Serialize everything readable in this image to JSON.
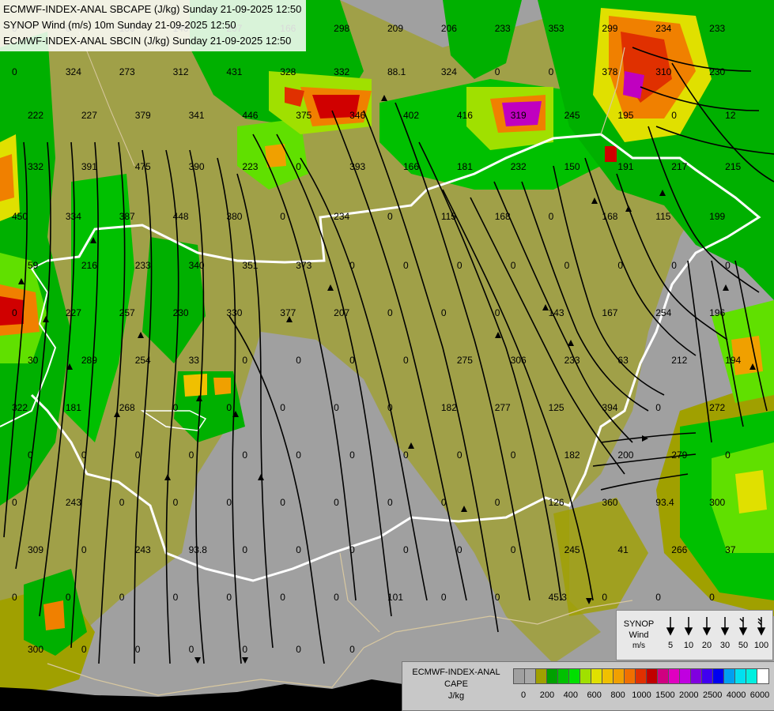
{
  "titles": {
    "line1": "ECMWF-INDEX-ANAL SBCAPE (J/kg) Sunday 21-09-2025 12:50",
    "line2": "SYNOP Wind (m/s) 10m Sunday 21-09-2025 12:50",
    "line3": "ECMWF-INDEX-ANAL SBCIN (J/kg) Sunday 21-09-2025 12:50"
  },
  "wind_legend": {
    "title": "SYNOP",
    "subtitle": "Wind",
    "unit": "m/s",
    "speeds": [
      "5",
      "10",
      "20",
      "30",
      "50",
      "100"
    ]
  },
  "cape_legend": {
    "title": "ECMWF-INDEX-ANAL",
    "subtitle": "CAPE",
    "unit": "J/kg",
    "tick_labels": [
      "0",
      "200",
      "400",
      "600",
      "800",
      "1000",
      "1500",
      "2000",
      "2500",
      "4000",
      "6000"
    ],
    "colors": [
      "#a0a0a0",
      "#a8a8a8",
      "#a0a000",
      "#00a000",
      "#00c000",
      "#00e000",
      "#a0e000",
      "#e0e000",
      "#f0c000",
      "#f0a000",
      "#f07000",
      "#e03000",
      "#c00000",
      "#d00080",
      "#e000c0",
      "#c000e0",
      "#8000e0",
      "#4000f0",
      "#0000f0",
      "#00a0f0",
      "#00e0f0",
      "#00f0e0",
      "#ffffff"
    ]
  },
  "colors": {
    "background_gray": "#a0a0a0",
    "olive": "#a0a000",
    "green": "#00b000",
    "light_green": "#60e000",
    "yellow": "#e0e000",
    "orange": "#f08000",
    "red": "#d00000",
    "magenta": "#c000c0",
    "border_white": "#ffffff",
    "boundary_tan": "#d8c8a0",
    "streamline_black": "#000000"
  },
  "map_values": [
    "0",
    "324",
    "273",
    "312",
    "431",
    "328",
    "332",
    "88.1",
    "324",
    "0",
    "0",
    "378",
    "310",
    "230",
    "222",
    "227",
    "379",
    "341",
    "446",
    "375",
    "346",
    "402",
    "416",
    "319",
    "245",
    "195",
    "0",
    "12",
    "0",
    "0",
    "100",
    "140",
    "207",
    "166",
    "298",
    "209",
    "206",
    "233",
    "353",
    "299",
    "234",
    "233",
    "332",
    "391",
    "475",
    "390",
    "223",
    "0",
    "393",
    "166",
    "181",
    "232",
    "150",
    "191",
    "217",
    "215",
    "450",
    "334",
    "387",
    "448",
    "380",
    "0",
    "234",
    "0",
    "115",
    "168",
    "0",
    "168",
    "115",
    "199",
    "59",
    "216",
    "233",
    "340",
    "351",
    "373",
    "0",
    "0",
    "0",
    "0",
    "0",
    "0",
    "0",
    "0",
    "0",
    "227",
    "257",
    "230",
    "330",
    "377",
    "207",
    "0",
    "0",
    "0",
    "143",
    "167",
    "254",
    "196",
    "30",
    "289",
    "254",
    "33",
    "0",
    "0",
    "0",
    "0",
    "275",
    "306",
    "233",
    "63",
    "212",
    "194",
    "322",
    "181",
    "268",
    "0",
    "0",
    "0",
    "0",
    "0",
    "182",
    "277",
    "125",
    "394",
    "0",
    "272",
    "0",
    "0",
    "0",
    "0",
    "0",
    "0",
    "0",
    "0",
    "0",
    "0",
    "182",
    "200",
    "279",
    "0",
    "0",
    "243",
    "0",
    "0",
    "0",
    "0",
    "0",
    "0",
    "0",
    "0",
    "126",
    "360",
    "93.4",
    "300",
    "309",
    "0",
    "243",
    "93.8",
    "0",
    "0",
    "0",
    "0",
    "0",
    "0",
    "245",
    "41",
    "266",
    "37",
    "0",
    "0",
    "0",
    "0",
    "0",
    "0",
    "0",
    "101",
    "0",
    "0",
    "45.3",
    "0",
    "0",
    "0",
    "300",
    "0",
    "0",
    "0",
    "0",
    "0",
    "0"
  ]
}
